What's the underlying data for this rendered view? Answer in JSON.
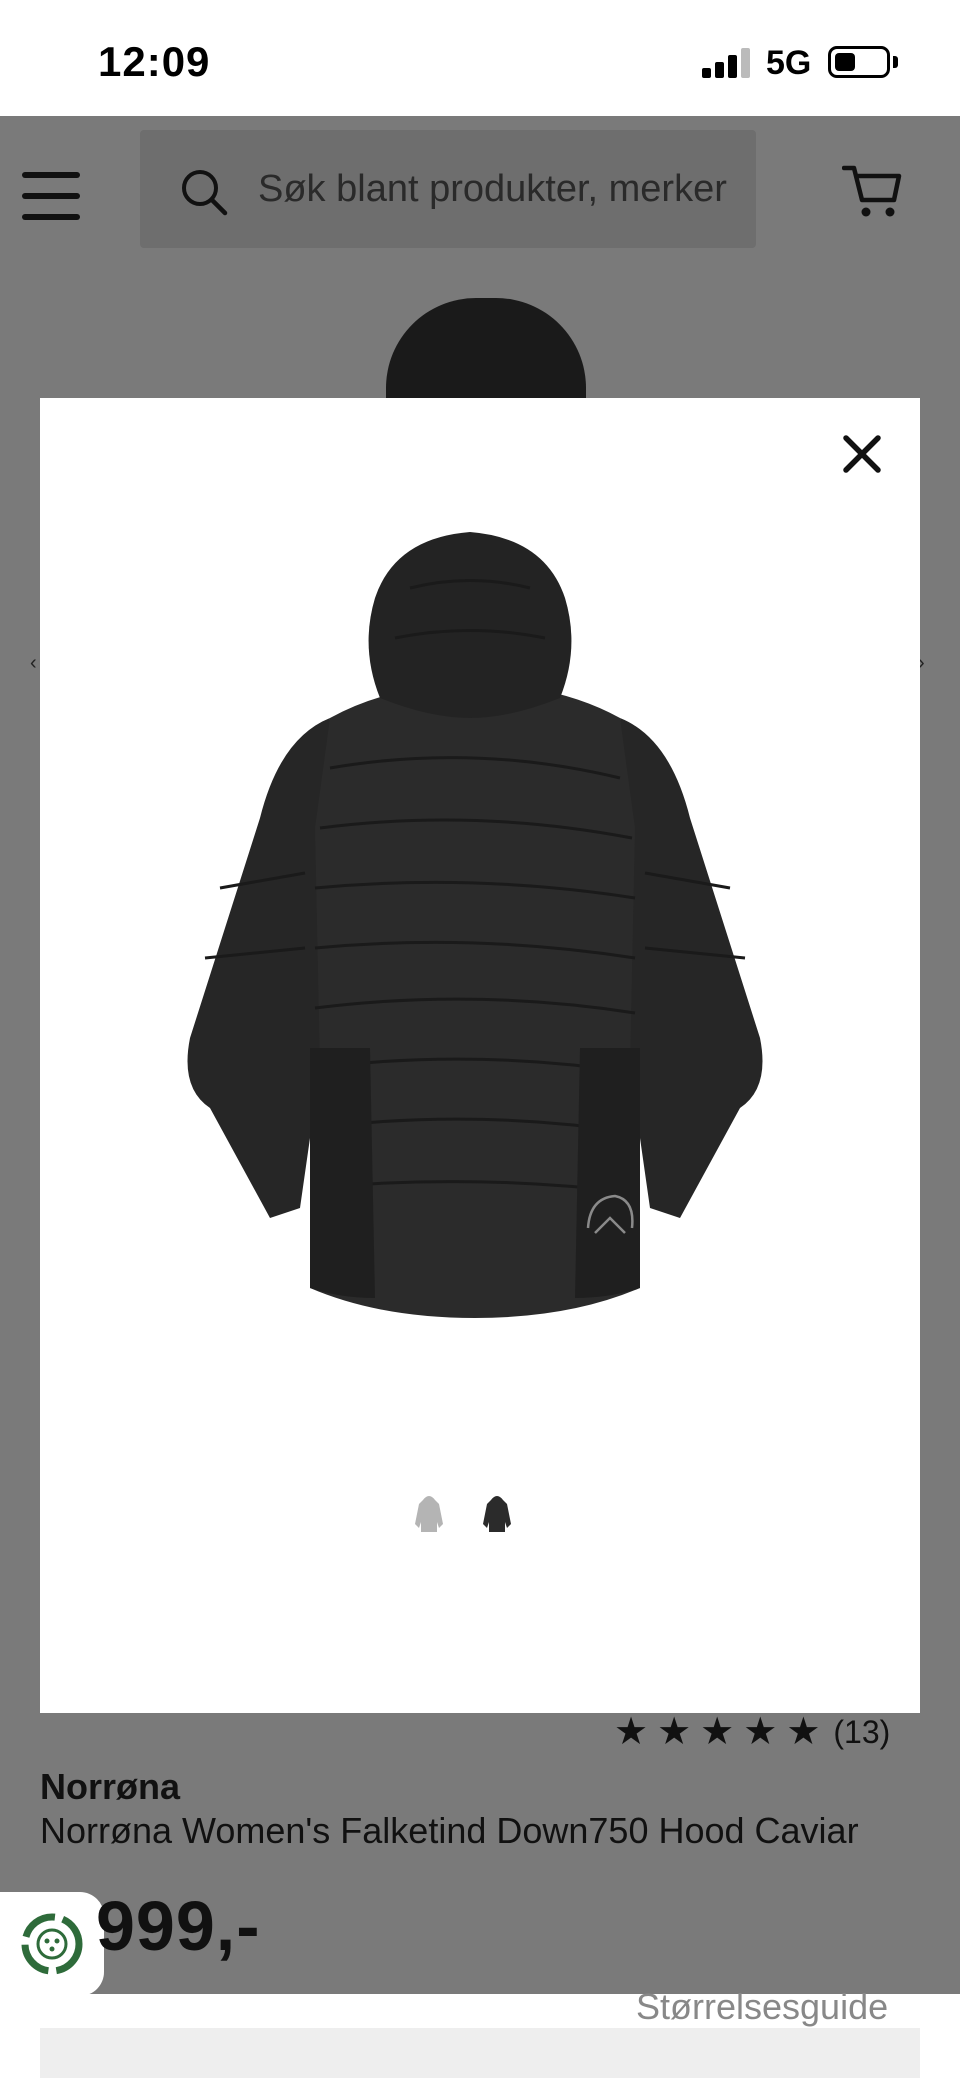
{
  "status_bar": {
    "time": "12:09",
    "network": "5G",
    "icons": [
      "signal-icon",
      "battery-icon"
    ]
  },
  "header": {
    "search_placeholder": "Søk blant produkter, merker",
    "icons": [
      "menu-icon",
      "search-icon",
      "cart-icon"
    ]
  },
  "modal": {
    "close_icon": "close-icon",
    "image_alt": "jacket-back-image",
    "thumbnails": [
      {
        "name": "thumbnail-front",
        "selected": false
      },
      {
        "name": "thumbnail-back",
        "selected": true
      }
    ]
  },
  "product": {
    "rating_stars": 5,
    "rating_count": "(13)",
    "brand": "Norrøna",
    "name": "Norrøna Women's Falketind Down750 Hood Caviar",
    "price": "999,-",
    "size_guide": "Størrelsesguide"
  },
  "colors": {
    "overlay": "#7a7a7a",
    "modal_bg": "#ffffff",
    "jacket": "#2b2b2b",
    "badge_green": "#2e6b3a"
  }
}
